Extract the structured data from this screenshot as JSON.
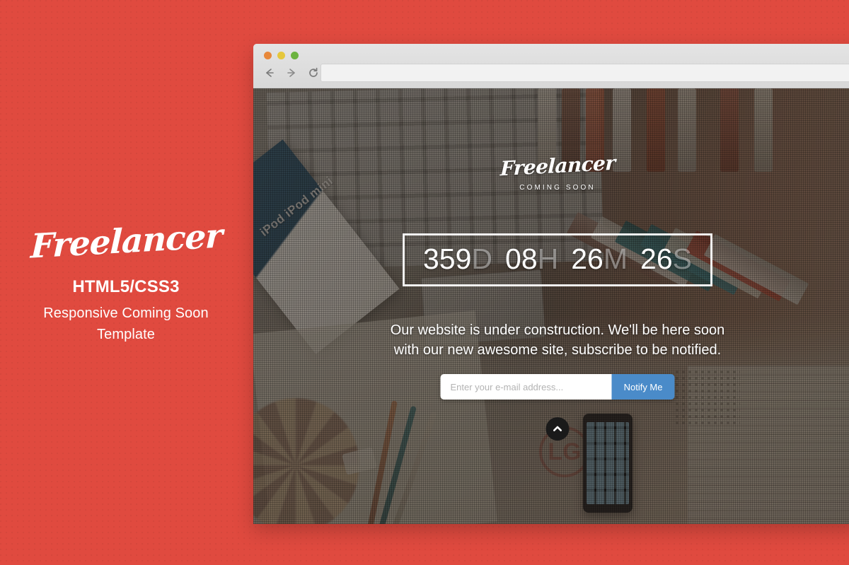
{
  "theme": {
    "backdrop_color": "#e04a3f",
    "accent_button_color": "#4a8bc9",
    "chrome_color": "#dedede"
  },
  "promo": {
    "logo": "Freelancer",
    "tech_label": "HTML5/CSS3",
    "description": "Responsive Coming Soon\nTemplate",
    "description_line1": "Responsive Coming Soon",
    "description_line2": "Template"
  },
  "browser": {
    "traffic_lights": [
      {
        "name": "close",
        "color": "#e8883a"
      },
      {
        "name": "minimize",
        "color": "#e5c73c"
      },
      {
        "name": "zoom",
        "color": "#6cb33f"
      }
    ],
    "nav": {
      "back_icon": "arrow-left-icon",
      "forward_icon": "arrow-right-icon",
      "reload_icon": "reload-icon"
    },
    "address_bar": {
      "value": "",
      "placeholder": ""
    }
  },
  "hero": {
    "site_logo": "Freelancer",
    "site_tagline": "COMING SOON",
    "countdown": {
      "days_value": "359",
      "days_suffix": "D",
      "hours_value": "08",
      "hours_suffix": "H",
      "minutes_value": "26",
      "minutes_suffix": "M",
      "seconds_value": "26",
      "seconds_suffix": "S",
      "full_text": "359D 08H 26M 26S"
    },
    "description_line1": "Our website is under construction. We'll be here soon",
    "description_line2": "with our new awesome site, subscribe to be notified.",
    "subscribe": {
      "email_placeholder": "Enter your e-mail address...",
      "email_value": "",
      "submit_label": "Notify Me"
    },
    "scroll_top_icon": "chevron-up-icon",
    "photo": {
      "ipod_box_label": "iPod  iPod mini",
      "lg_logo_text": "LG"
    }
  }
}
